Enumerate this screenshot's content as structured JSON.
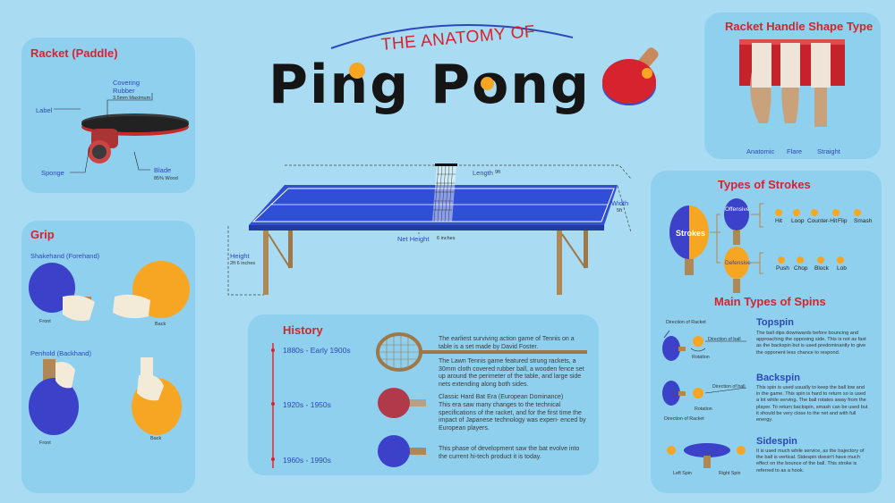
{
  "title": {
    "line1": "THE ANATOMY OF",
    "line2": "Ping Pong"
  },
  "colors": {
    "background": "#a9dcf2",
    "panel": "#8fd0ee",
    "title_red": "#d6232e",
    "label_blue": "#2c49b8",
    "ball_orange": "#f6a623",
    "table_blue": "#2f4fd6",
    "wood": "#b08856"
  },
  "racket": {
    "title": "Racket (Paddle)",
    "covering_rubber": "Covering Rubber",
    "covering_note": "3.5mm Maximum",
    "label": "Label",
    "sponge": "Sponge",
    "blade": "Blade",
    "blade_note": "85% Wood"
  },
  "grip": {
    "title": "Grip",
    "shakehand": "Shakehand (Forehand)",
    "penhold": "Penhold (Backhand)",
    "front": "Front",
    "back": "Back"
  },
  "table": {
    "length": "Length",
    "length_value": "9ft",
    "width": "Width",
    "width_value": "5ft",
    "net_height": "Net Height",
    "net_value": "6 inches",
    "height": "Height",
    "height_value": "2ft 6 inches"
  },
  "history": {
    "title": "History",
    "eras": [
      {
        "date": "1880s - Early 1900s",
        "texts": [
          "The earliest surviving action game of Tennis on a table is a set made by David Foster.",
          "The Lawn Tennis game featured strung rackets, a 30mm cloth covered rubber ball, a wooden fence set up around the perimeter of the table, and large side nets extending along both sides."
        ]
      },
      {
        "date": "1920s - 1950s",
        "texts": [
          "Classic Hard Bat Era (European Dominance)",
          "This era saw many changes to the technical specifications of the racket, and for the first time the impact of Japanese technology was experi- enced by European players."
        ]
      },
      {
        "date": "1960s - 1990s",
        "texts": [
          "This phase of development saw the bat evolve into the current hi-tech product it is today."
        ]
      }
    ]
  },
  "handle": {
    "title": "Racket Handle Shape Type",
    "types": [
      "Anatomic",
      "Flare",
      "Straight"
    ]
  },
  "strokes": {
    "title": "Types of Strokes",
    "center": "Strokes",
    "offensive": "Offensive",
    "defensive": "Defensive",
    "offensive_items": [
      "Hit",
      "Loop",
      "Counter-Hit",
      "Flip",
      "Smash"
    ],
    "defensive_items": [
      "Push",
      "Chop",
      "Block",
      "Lob"
    ]
  },
  "spins": {
    "title": "Main Types of Spins",
    "topspin": {
      "name": "Topspin",
      "text": "The ball dips downwards before bouncing and approaching the opposing side. This is not as fast as the backspin but is used predominantly to give the opponent less chance to respond.",
      "dir_racket": "Direction of Racket",
      "dir_ball": "Direction of ball",
      "rotation": "Rotation"
    },
    "backspin": {
      "name": "Backspin",
      "text": "This spin is used usually to keep the ball low and in the game. This spin is hard to return so is used a lot while serving. The ball rotates away from the player. To return backspin, smash can be used but it should be very close to the net and with full energy.",
      "dir_racket": "Direction of Racket",
      "dir_ball": "Direction of ball",
      "rotation": "Rotation"
    },
    "sidespin": {
      "name": "Sidespin",
      "text": "It is used much while service, as the trajectory of the ball is vertical. Sidespin doesn't have much effect on the bounce of the ball. This stroke is referred to as a hook.",
      "left": "Left Spin",
      "right": "Right Spin"
    }
  }
}
